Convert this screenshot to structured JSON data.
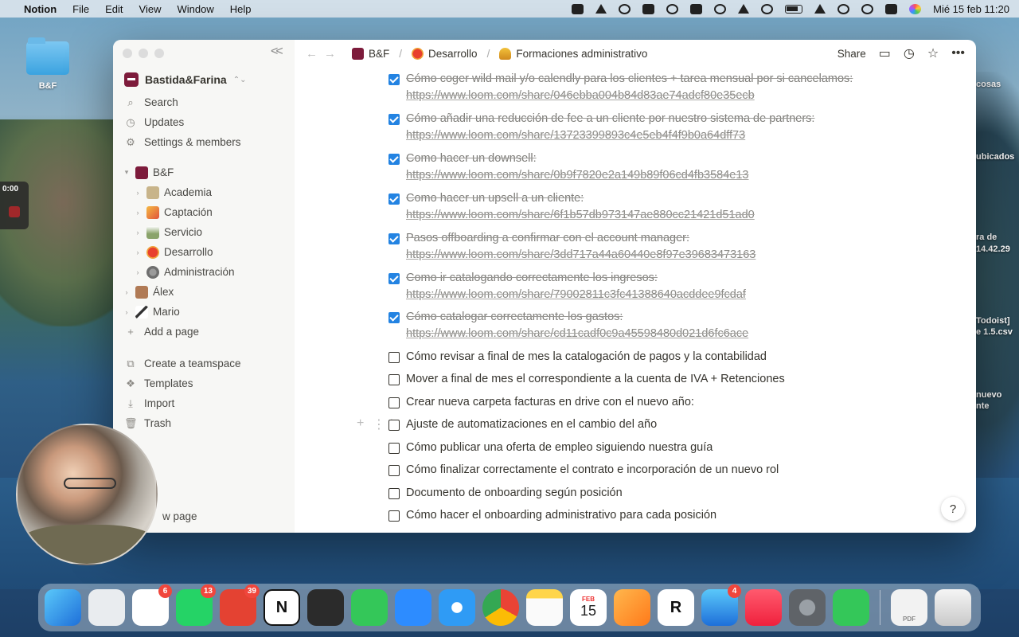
{
  "menubar": {
    "app_name": "Notion",
    "menus": [
      "File",
      "Edit",
      "View",
      "Window",
      "Help"
    ],
    "datetime": "Mié 15 feb 11:20"
  },
  "desktop": {
    "bf_folder": "B&F",
    "right_labels": [
      "cosas",
      "ubicados",
      "ra de",
      "14.42.29",
      "Todoist]",
      "e 1.5.csv",
      "nuevo",
      "nte"
    ]
  },
  "recording": {
    "timer": "0:00"
  },
  "sidebar": {
    "workspace": "Bastida&Farina",
    "nav": [
      {
        "label": "Search",
        "icon": "search-icon"
      },
      {
        "label": "Updates",
        "icon": "clock-icon"
      },
      {
        "label": "Settings & members",
        "icon": "gear-icon"
      }
    ],
    "teamspace": "B&F",
    "pages": [
      {
        "label": "Academia",
        "icon": "classical-building-icon"
      },
      {
        "label": "Captación",
        "icon": "party-popper-icon"
      },
      {
        "label": "Servicio",
        "icon": "mountain-icon"
      },
      {
        "label": "Desarrollo",
        "icon": "ping-pong-icon"
      },
      {
        "label": "Administración",
        "icon": "gear-icon"
      }
    ],
    "private": [
      {
        "label": "Álex",
        "icon": "avatar"
      },
      {
        "label": "Mario",
        "icon": "pen-icon"
      }
    ],
    "add_page": "Add a page",
    "bottom": [
      {
        "label": "Create a teamspace",
        "icon": "teamspace-icon"
      },
      {
        "label": "Templates",
        "icon": "templates-icon"
      },
      {
        "label": "Import",
        "icon": "import-icon"
      },
      {
        "label": "Trash",
        "icon": "trash-icon"
      }
    ],
    "new_page": "w page"
  },
  "topbar": {
    "breadcrumb": [
      "B&F",
      "Desarrollo",
      "Formaciones administrativo"
    ],
    "share": "Share"
  },
  "tasks": [
    {
      "done": true,
      "title": "Cómo coger wild mail y/o calendly para los clientes + tarea mensual por si cancelamos:",
      "link": "https://www.loom.com/share/046ebba004b84d83ae74adcf80e35ecb"
    },
    {
      "done": true,
      "title": "Cómo añadir una reducción de fee a un cliente por nuestro sistema de partners:",
      "link": "https://www.loom.com/share/13723399893c4e5eb4f4f9b0a64dff73"
    },
    {
      "done": true,
      "title": "Como hacer un downsell:",
      "link": "https://www.loom.com/share/0b9f7820e2a149b89f06cd4fb3584e13"
    },
    {
      "done": true,
      "title": "Como hacer un upsell a un cliente:",
      "link": "https://www.loom.com/share/6f1b57db973147ae880cc21421d51ad0"
    },
    {
      "done": true,
      "title": "Pasos offboarding a confirmar con el account manager:",
      "link": "https://www.loom.com/share/3dd717a44a60440e8f97e39683473163"
    },
    {
      "done": true,
      "title": "Como ir catalogando correctamente los ingresos:",
      "link": "https://www.loom.com/share/79002811c3fc41388640acddee9fcdaf"
    },
    {
      "done": true,
      "title": "Cómo catalogar correctamente los gastos:",
      "link": "https://www.loom.com/share/cd11cadf0c9a45598480d021d6fc6ace"
    },
    {
      "done": false,
      "title": "Cómo revisar a final de mes la catalogación de pagos y la contabilidad"
    },
    {
      "done": false,
      "title": "Mover a final de mes el correspondiente a la cuenta de IVA + Retenciones"
    },
    {
      "done": false,
      "title": "Crear nueva carpeta facturas en drive con el nuevo año:"
    },
    {
      "done": false,
      "title": "Ajuste de automatizaciones en el cambio del año"
    },
    {
      "done": false,
      "title": "Cómo publicar una oferta de empleo siguiendo nuestra guía"
    },
    {
      "done": false,
      "title": "Cómo finalizar correctamente el contrato e incorporación de un nuevo rol"
    },
    {
      "done": false,
      "title": "Documento de onboarding según posición"
    },
    {
      "done": false,
      "title": "Cómo hacer el onboarding administrativo para cada posición"
    }
  ],
  "help": "?",
  "dock": {
    "badges": {
      "slack": "6",
      "whatsapp": "13",
      "todoist": "39",
      "mail": "4"
    },
    "calendar_month": "FEB",
    "calendar_day": "15",
    "pdf_label": "PDF"
  },
  "colors": {
    "checkbox": "#2383e2",
    "sidebar_bg": "#f7f7f5",
    "workspace_logo": "#7d1b3b",
    "badge": "#f0463c"
  }
}
